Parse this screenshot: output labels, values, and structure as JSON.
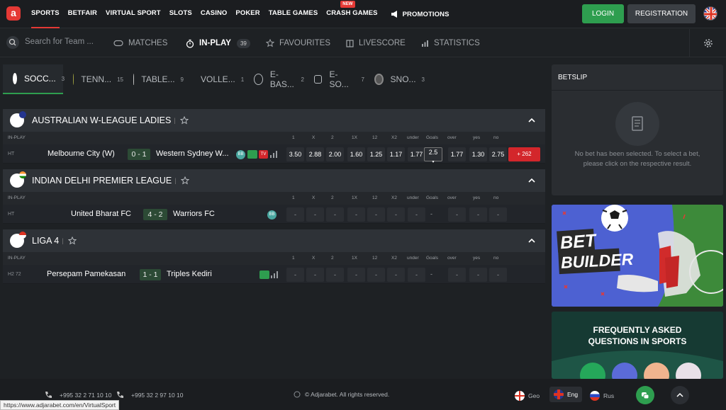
{
  "topnav": {
    "items": [
      "SPORTS",
      "BETFAIR",
      "VIRTUAL SPORT",
      "SLOTS",
      "CASINO",
      "POKER",
      "TABLE GAMES",
      "CRASH GAMES"
    ],
    "new_badge": "NEW",
    "promotions": "PROMOTIONS",
    "login": "LOGIN",
    "registration": "REGISTRATION"
  },
  "subnav": {
    "search_placeholder": "Search for Team ...",
    "matches": "MATCHES",
    "inplay": "IN-PLAY",
    "inplay_count": "39",
    "favourites": "FAVOURITES",
    "livescore": "LIVESCORE",
    "statistics": "STATISTICS"
  },
  "sport_tabs": [
    {
      "label": "SOCC...",
      "count": "3",
      "icon": "soccer-ball-icon"
    },
    {
      "label": "TENN...",
      "count": "15",
      "icon": "tennis-ball-icon"
    },
    {
      "label": "TABLE...",
      "count": "9",
      "icon": "table-tennis-icon"
    },
    {
      "label": "VOLLE...",
      "count": "1",
      "icon": "volleyball-icon"
    },
    {
      "label": "E-BAS...",
      "count": "2",
      "icon": "basketball-icon"
    },
    {
      "label": "E-SO...",
      "count": "7",
      "icon": "esoccer-icon"
    },
    {
      "label": "SNO...",
      "count": "3",
      "icon": "snooker-icon"
    }
  ],
  "odds_headers": [
    "1",
    "X",
    "2",
    "1X",
    "12",
    "X2",
    "under",
    "Goals",
    "over",
    "yes",
    "no"
  ],
  "inplay_label": "IN-PLAY",
  "leagues": [
    {
      "name": "AUSTRALIAN W-LEAGUE LADIES",
      "match": {
        "period": "HT",
        "home": "Melbourne City (W)",
        "score": "0 - 1",
        "away": "Western Sydney W...",
        "odds": [
          "3.50",
          "2.88",
          "2.00",
          "1.60",
          "1.25",
          "1.17",
          "1.77",
          "2.5",
          "1.77",
          "1.30",
          "2.75"
        ],
        "more": "+ 262",
        "tags": [
          "BB",
          "TV"
        ]
      }
    },
    {
      "name": "INDIAN DELHI PREMIER LEAGUE",
      "match": {
        "period": "HT",
        "home": "United Bharat FC",
        "score": "4 - 2",
        "away": "Warriors FC",
        "odds": [
          "-",
          "-",
          "-",
          "-",
          "-",
          "-",
          "-",
          "-",
          "-",
          "-",
          "-"
        ],
        "tags": [
          "BB"
        ]
      }
    },
    {
      "name": "LIGA 4",
      "match": {
        "period": "H2 72",
        "home": "Persepam Pamekasan",
        "score": "1 - 1",
        "away": "Triples Kediri",
        "odds": [
          "-",
          "-",
          "-",
          "-",
          "-",
          "-",
          "-",
          "-",
          "-",
          "-",
          "-"
        ],
        "tags": []
      }
    }
  ],
  "betslip": {
    "title": "BETSLIP",
    "empty_text": "No bet has been selected. To select a bet, please click on the respective result."
  },
  "promos": {
    "bet": "BET",
    "builder": "BUILDER",
    "faq_line1": "FREQUENTLY ASKED",
    "faq_line2": "QUESTIONS IN SPORTS"
  },
  "footer": {
    "phone1": "+995 32 2 71 10 10",
    "phone2": "+995 32 2 97 10 10",
    "copyright": "© Adjarabet. All rights reserved.",
    "lang_geo": "Geo",
    "lang_eng": "Eng",
    "lang_rus": "Rus",
    "status_url": "https://www.adjarabet.com/en/VirtualSport"
  }
}
